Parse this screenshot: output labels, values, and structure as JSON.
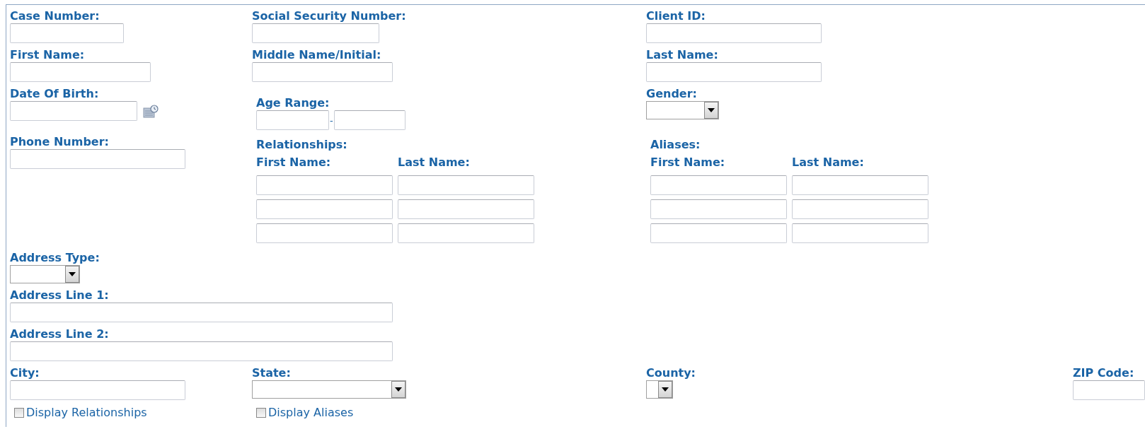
{
  "rows": [
    [
      {
        "kind": "text",
        "label": "Case Number:"
      },
      {
        "kind": "text",
        "label": "Social Security Number:"
      },
      {
        "kind": "text",
        "label": "Client ID:"
      }
    ],
    [
      {
        "kind": "text",
        "label": "First Name:"
      },
      {
        "kind": "text",
        "label": "Middle Name/Initial:"
      },
      {
        "kind": "text",
        "label": "Last Name:"
      }
    ],
    [
      {
        "kind": "date",
        "label": "Date Of Birth:"
      },
      {
        "kind": "range",
        "label": "Age Range:",
        "separator": "-"
      },
      {
        "kind": "select",
        "label": "Gender:"
      }
    ],
    [
      {
        "kind": "text",
        "label": "Phone Number:"
      },
      {
        "kind": "names",
        "label": "Relationships:",
        "columns": [
          "First Name:",
          "Last Name:"
        ]
      },
      {
        "kind": "names",
        "label": "Aliases:",
        "columns": [
          "First Name:",
          "Last Name:"
        ]
      }
    ]
  ],
  "address": [
    {
      "kind": "select",
      "label": "Address Type:"
    },
    {
      "kind": "text",
      "label": "Address Line 1:"
    },
    {
      "kind": "text",
      "label": "Address Line 2:"
    }
  ],
  "location": [
    {
      "kind": "text",
      "label": "City:"
    },
    {
      "kind": "select",
      "label": "State:"
    },
    {
      "kind": "select",
      "label": "County:"
    },
    {
      "kind": "text",
      "label": "ZIP Code:"
    }
  ],
  "checkboxes": [
    {
      "label": "Display Relationships",
      "checked": false
    },
    {
      "label": "Display Aliases",
      "checked": false
    }
  ]
}
